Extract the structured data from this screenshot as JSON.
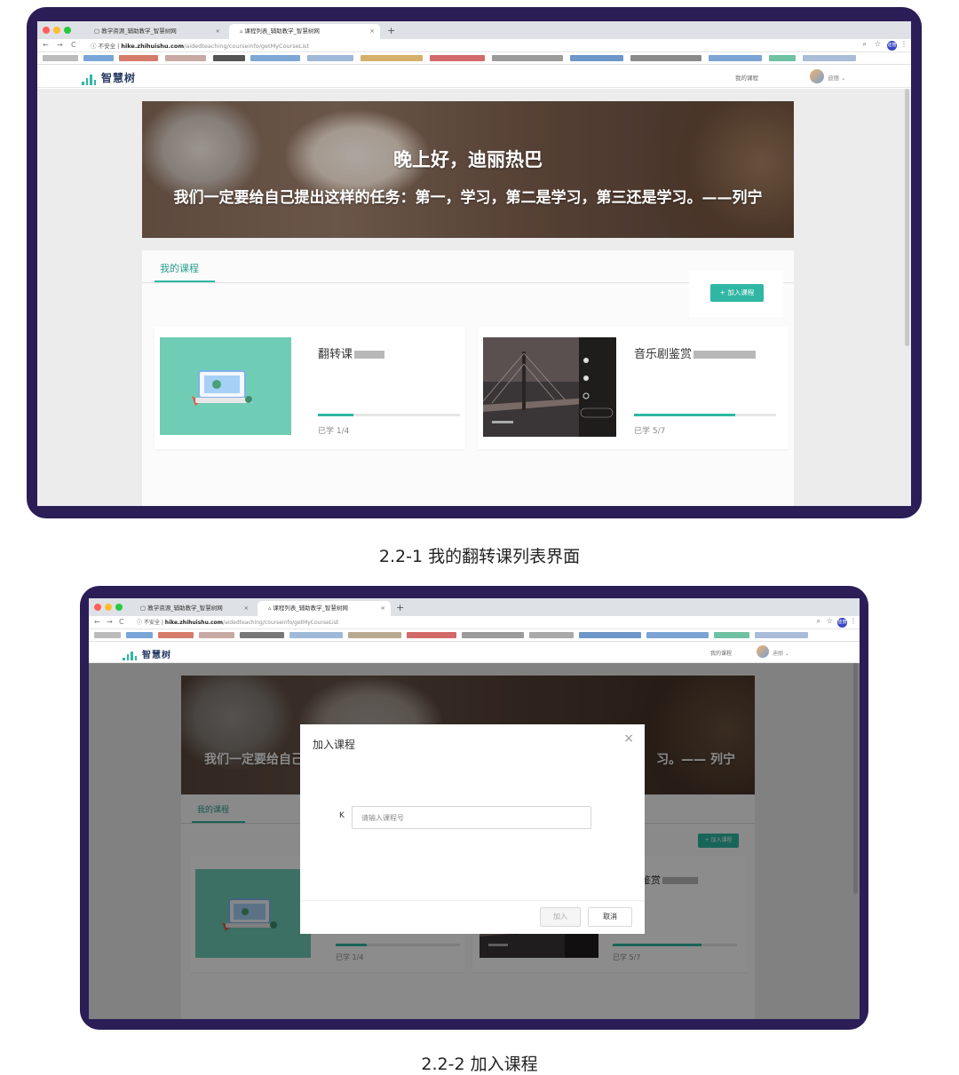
{
  "browser": {
    "tabs": [
      "教学资源_辅助教学_智慧树网",
      "课程列表_辅助教学_智慧树网"
    ],
    "url_insecure": "不安全",
    "url_host": "hike.zhihuishu.com",
    "url_path": "/aidedteaching/courseinfo/getMyCourseList",
    "profile_label": "迪丽",
    "close_glyph": "×",
    "newtab_glyph": "+",
    "back_glyph": "←",
    "forward_glyph": "→",
    "reload_glyph": "C",
    "info_glyph": "ⓘ",
    "zoom_glyph": "⌕",
    "star_glyph": "☆",
    "menu_glyph": "⋮"
  },
  "site": {
    "logo_text": "智慧树",
    "nav_my_course": "我的课程",
    "user_name": "迪丽 ⌄"
  },
  "banner": {
    "greeting": "晚上好，迪丽热巴",
    "quote": "我们一定要给自己提出这样的任务：第一，学习，第二是学习，第三还是学习。——列宁",
    "quote_short_left": "我们一定要给自己",
    "quote_short_right": "习。—— 列宁"
  },
  "panel": {
    "tab_label": "我的课程",
    "add_button": "+ 加入课程"
  },
  "courses": [
    {
      "title": "翻转课",
      "progress_text": "已学 1/4",
      "progress": 0.25
    },
    {
      "title": "音乐剧鉴赏",
      "progress_text": "已学 5/7",
      "progress": 0.714
    }
  ],
  "second_card_title_visible": "鉴赏",
  "modal": {
    "title": "加入课程",
    "close": "×",
    "field_label": "K",
    "placeholder": "请输入课程号",
    "join_button": "加入",
    "cancel_button": "取消"
  },
  "captions": {
    "fig1": "2.2-1 我的翻转课列表界面",
    "fig2": "2.2-2 加入课程"
  },
  "colors": {
    "brand": "#2fb7a3",
    "frame": "#2b1d56"
  }
}
